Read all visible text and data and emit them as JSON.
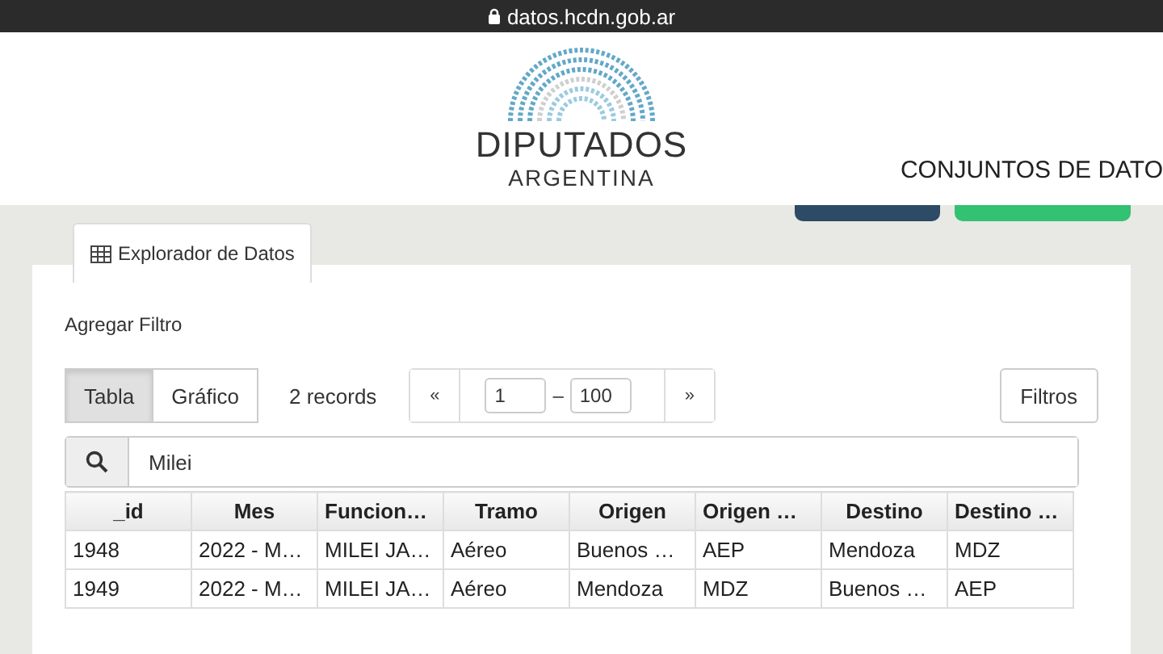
{
  "browser": {
    "url": "datos.hcdn.gob.ar"
  },
  "header": {
    "logo_title": "DIPUTADOS",
    "logo_subtitle": "ARGENTINA",
    "nav_item": "CONJUNTOS DE DATO"
  },
  "tabs": [
    {
      "label": "Explorador de Datos",
      "selected": true
    }
  ],
  "explorer": {
    "filter_label": "Agregar Filtro",
    "views": [
      {
        "label": "Tabla",
        "selected": true
      },
      {
        "label": "Gráfico",
        "selected": false
      }
    ],
    "record_count": "2 records",
    "pager": {
      "prev": "«",
      "from": "1",
      "separator": "–",
      "to": "100",
      "next": "»"
    },
    "filters_button": "Filtros",
    "search": {
      "value": "Milei"
    }
  },
  "table": {
    "columns": [
      "_id",
      "Mes",
      "Funcion…",
      "Tramo",
      "Origen",
      "Origen …",
      "Destino",
      "Destino …"
    ],
    "rows": [
      [
        "1948",
        "2022 - M…",
        "MILEI JA…",
        "Aéreo",
        "Buenos …",
        "AEP",
        "Mendoza",
        "MDZ"
      ],
      [
        "1949",
        "2022 - M…",
        "MILEI JA…",
        "Aéreo",
        "Mendoza",
        "MDZ",
        "Buenos …",
        "AEP"
      ]
    ]
  }
}
